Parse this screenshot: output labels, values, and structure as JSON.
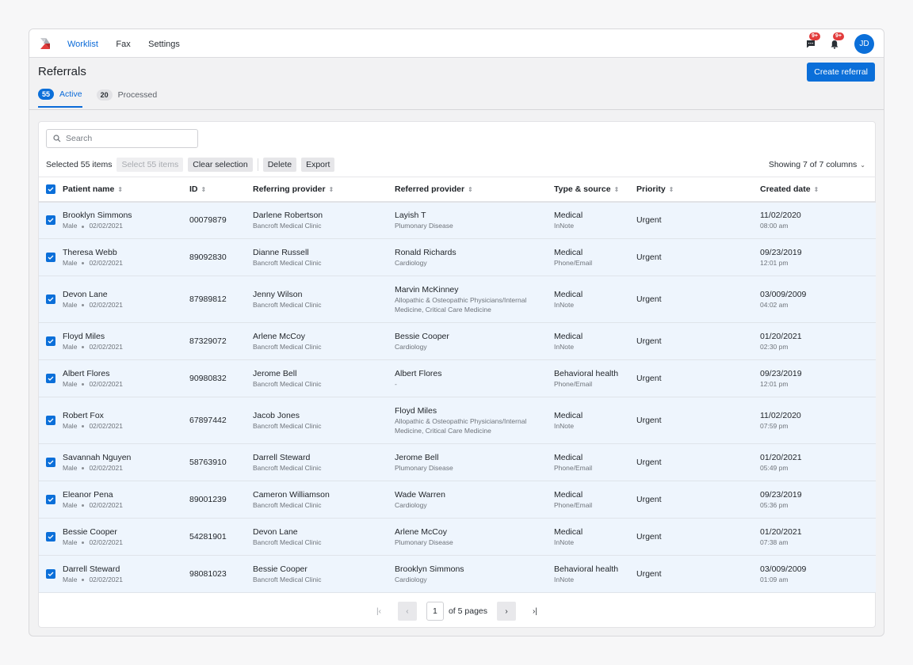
{
  "nav": {
    "items": [
      {
        "label": "Worklist",
        "active": true
      },
      {
        "label": "Fax",
        "active": false
      },
      {
        "label": "Settings",
        "active": false
      }
    ],
    "messages_badge": "9+",
    "notifications_badge": "9+",
    "avatar_initials": "JD"
  },
  "header": {
    "title": "Referrals",
    "create_button": "Create referral",
    "tabs": [
      {
        "count": "55",
        "label": "Active",
        "active": true
      },
      {
        "count": "20",
        "label": "Processed",
        "active": false
      }
    ]
  },
  "toolbar": {
    "search_placeholder": "Search",
    "search_value": "",
    "selected_text": "Selected 55 items",
    "select_all_label": "Select 55 items",
    "clear_label": "Clear selection",
    "delete_label": "Delete",
    "export_label": "Export",
    "columns_label": "Showing 7 of 7 columns"
  },
  "table": {
    "columns": [
      "Patient name",
      "ID",
      "Referring provider",
      "Referred provider",
      "Type & source",
      "Priority",
      "Created date"
    ],
    "rows": [
      {
        "name": "Brooklyn Simmons",
        "gender": "Male",
        "dob": "02/02/2021",
        "id": "00079879",
        "referring": "Darlene Robertson",
        "referring_org": "Bancroft Medical Clinic",
        "referred": "Layish T",
        "specialty": "Plumonary Disease",
        "type": "Medical",
        "source": "InNote",
        "priority": "Urgent",
        "date": "11/02/2020",
        "time": "08:00 am",
        "checked": true
      },
      {
        "name": "Theresa Webb",
        "gender": "Male",
        "dob": "02/02/2021",
        "id": "89092830",
        "referring": "Dianne Russell",
        "referring_org": "Bancroft Medical Clinic",
        "referred": "Ronald Richards",
        "specialty": "Cardiology",
        "type": "Medical",
        "source": "Phone/Email",
        "priority": "Urgent",
        "date": "09/23/2019",
        "time": "12:01 pm",
        "checked": true
      },
      {
        "name": "Devon Lane",
        "gender": "Male",
        "dob": "02/02/2021",
        "id": "87989812",
        "referring": "Jenny Wilson",
        "referring_org": "Bancroft Medical Clinic",
        "referred": "Marvin McKinney",
        "specialty": "Allopathic & Osteopathic Physicians/Internal Medicine, Critical Care Medicine",
        "type": "Medical",
        "source": "InNote",
        "priority": "Urgent",
        "date": "03/009/2009",
        "time": "04:02 am",
        "checked": true
      },
      {
        "name": "Floyd Miles",
        "gender": "Male",
        "dob": "02/02/2021",
        "id": "87329072",
        "referring": "Arlene McCoy",
        "referring_org": "Bancroft Medical Clinic",
        "referred": "Bessie Cooper",
        "specialty": "Cardiology",
        "type": "Medical",
        "source": "InNote",
        "priority": "Urgent",
        "date": "01/20/2021",
        "time": "02:30 pm",
        "checked": true
      },
      {
        "name": "Albert Flores",
        "gender": "Male",
        "dob": "02/02/2021",
        "id": "90980832",
        "referring": "Jerome Bell",
        "referring_org": "Bancroft Medical Clinic",
        "referred": "Albert Flores",
        "specialty": "-",
        "type": "Behavioral health",
        "source": "Phone/Email",
        "priority": "Urgent",
        "date": "09/23/2019",
        "time": "12:01 pm",
        "checked": true
      },
      {
        "name": "Robert Fox",
        "gender": "Male",
        "dob": "02/02/2021",
        "id": "67897442",
        "referring": "Jacob Jones",
        "referring_org": "Bancroft Medical Clinic",
        "referred": "Floyd Miles",
        "specialty": "Allopathic & Osteopathic Physicians/Internal Medicine, Critical Care Medicine",
        "type": "Medical",
        "source": "InNote",
        "priority": "Urgent",
        "date": "11/02/2020",
        "time": "07:59 pm",
        "checked": true
      },
      {
        "name": "Savannah Nguyen",
        "gender": "Male",
        "dob": "02/02/2021",
        "id": "58763910",
        "referring": "Darrell Steward",
        "referring_org": "Bancroft Medical Clinic",
        "referred": "Jerome Bell",
        "specialty": "Plumonary Disease",
        "type": "Medical",
        "source": "Phone/Email",
        "priority": "Urgent",
        "date": "01/20/2021",
        "time": "05:49 pm",
        "checked": true
      },
      {
        "name": "Eleanor Pena",
        "gender": "Male",
        "dob": "02/02/2021",
        "id": "89001239",
        "referring": "Cameron Williamson",
        "referring_org": "Bancroft Medical Clinic",
        "referred": "Wade Warren",
        "specialty": "Cardiology",
        "type": "Medical",
        "source": "Phone/Email",
        "priority": "Urgent",
        "date": "09/23/2019",
        "time": "05:36 pm",
        "checked": true
      },
      {
        "name": "Bessie Cooper",
        "gender": "Male",
        "dob": "02/02/2021",
        "id": "54281901",
        "referring": "Devon Lane",
        "referring_org": "Bancroft Medical Clinic",
        "referred": "Arlene McCoy",
        "specialty": "Plumonary Disease",
        "type": "Medical",
        "source": "InNote",
        "priority": "Urgent",
        "date": "01/20/2021",
        "time": "07:38 am",
        "checked": true
      },
      {
        "name": "Darrell Steward",
        "gender": "Male",
        "dob": "02/02/2021",
        "id": "98081023",
        "referring": "Bessie Cooper",
        "referring_org": "Bancroft Medical Clinic",
        "referred": "Brooklyn Simmons",
        "specialty": "Cardiology",
        "type": "Behavioral health",
        "source": "InNote",
        "priority": "Urgent",
        "date": "03/009/2009",
        "time": "01:09 am",
        "checked": true
      }
    ]
  },
  "pagination": {
    "current_page": "1",
    "total_label": "of 5 pages"
  },
  "colors": {
    "accent": "#0b6fd9",
    "badge": "#e23b3b",
    "selected_row": "#eef5fd"
  }
}
